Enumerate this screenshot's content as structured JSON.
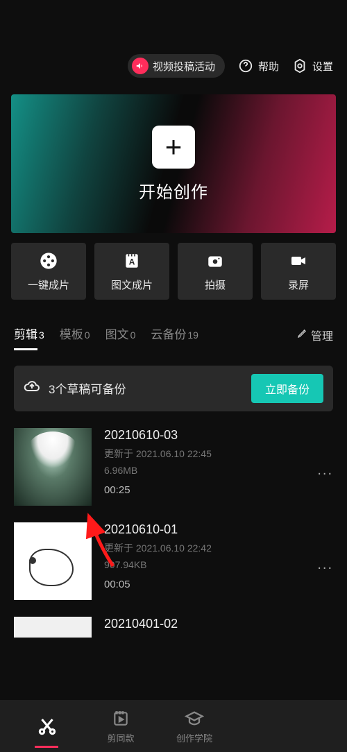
{
  "topbar": {
    "activity_label": "视频投稿活动",
    "help_label": "帮助",
    "settings_label": "设置"
  },
  "hero": {
    "start_label": "开始创作"
  },
  "actions": {
    "one_click": "一键成片",
    "image_text": "图文成片",
    "shoot": "拍摄",
    "record": "录屏"
  },
  "tabs": {
    "edit_label": "剪辑",
    "edit_count": "3",
    "template_label": "模板",
    "template_count": "0",
    "image_text_label": "图文",
    "image_text_count": "0",
    "cloud_label": "云备份",
    "cloud_count": "19",
    "manage_label": "管理"
  },
  "backup": {
    "message": "3个草稿可备份",
    "button": "立即备份"
  },
  "drafts": [
    {
      "title": "20210610-03",
      "updated": "更新于 2021.06.10 22:45",
      "size": "6.96MB",
      "duration": "00:25"
    },
    {
      "title": "20210610-01",
      "updated": "更新于 2021.06.10 22:42",
      "size": "907.94KB",
      "duration": "00:05"
    },
    {
      "title": "20210401-02",
      "updated": "",
      "size": "",
      "duration": ""
    }
  ],
  "nav": {
    "edit": "",
    "same": "剪同款",
    "academy": "创作学院"
  },
  "colors": {
    "accent_pink": "#ff2d5b",
    "accent_teal": "#16c7b4"
  }
}
